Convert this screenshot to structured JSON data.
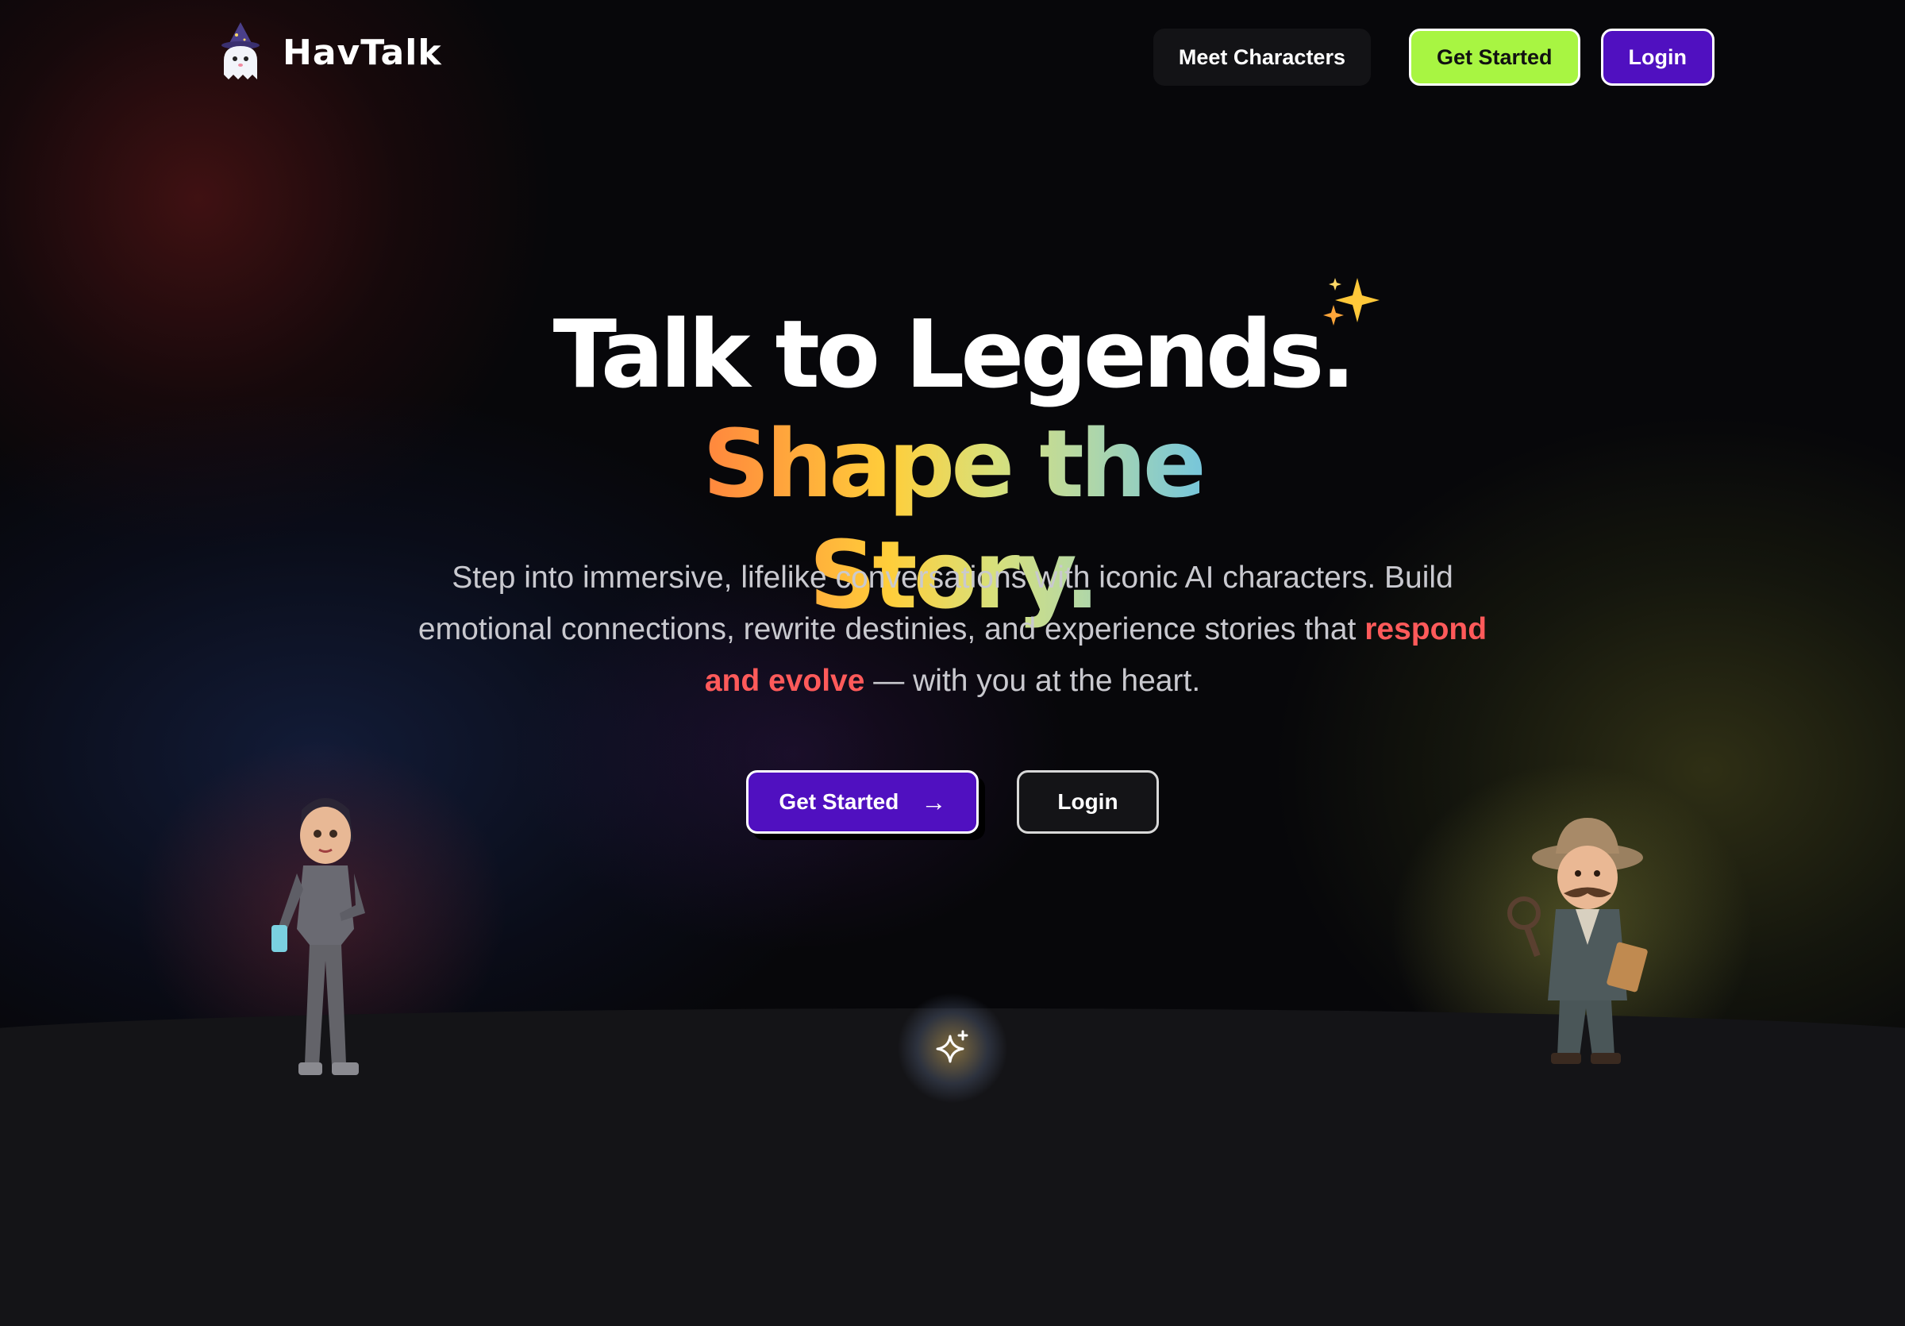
{
  "header": {
    "brand": "HavTalk",
    "nav": {
      "meet_characters": "Meet Characters",
      "get_started": "Get Started",
      "login": "Login"
    }
  },
  "hero": {
    "title_line1": "Talk to Legends.",
    "title_line2": "Shape the Story.",
    "description_part1": "Step into immersive, lifelike conversations with iconic AI characters. Build emotional connections, rewrite destinies, and experience stories that ",
    "description_highlight": "respond and evolve",
    "description_part2": " — with you at the heart.",
    "cta_primary": "Get Started",
    "cta_primary_icon": "arrow-right-icon",
    "cta_secondary": "Login"
  },
  "colors": {
    "lime": "#a8f542",
    "purple": "#5010c0",
    "highlight": "#ff5a5a",
    "gradient": [
      "#ff5d5d",
      "#ff8a3d",
      "#ffce3a",
      "#d8e07a",
      "#b9d9a0",
      "#7cc8d6",
      "#4aa3ff"
    ]
  },
  "icons": {
    "logo": "ghost-wizard-icon",
    "title_decoration": "sparkles-icon",
    "bottom": "sparkle-icon"
  }
}
